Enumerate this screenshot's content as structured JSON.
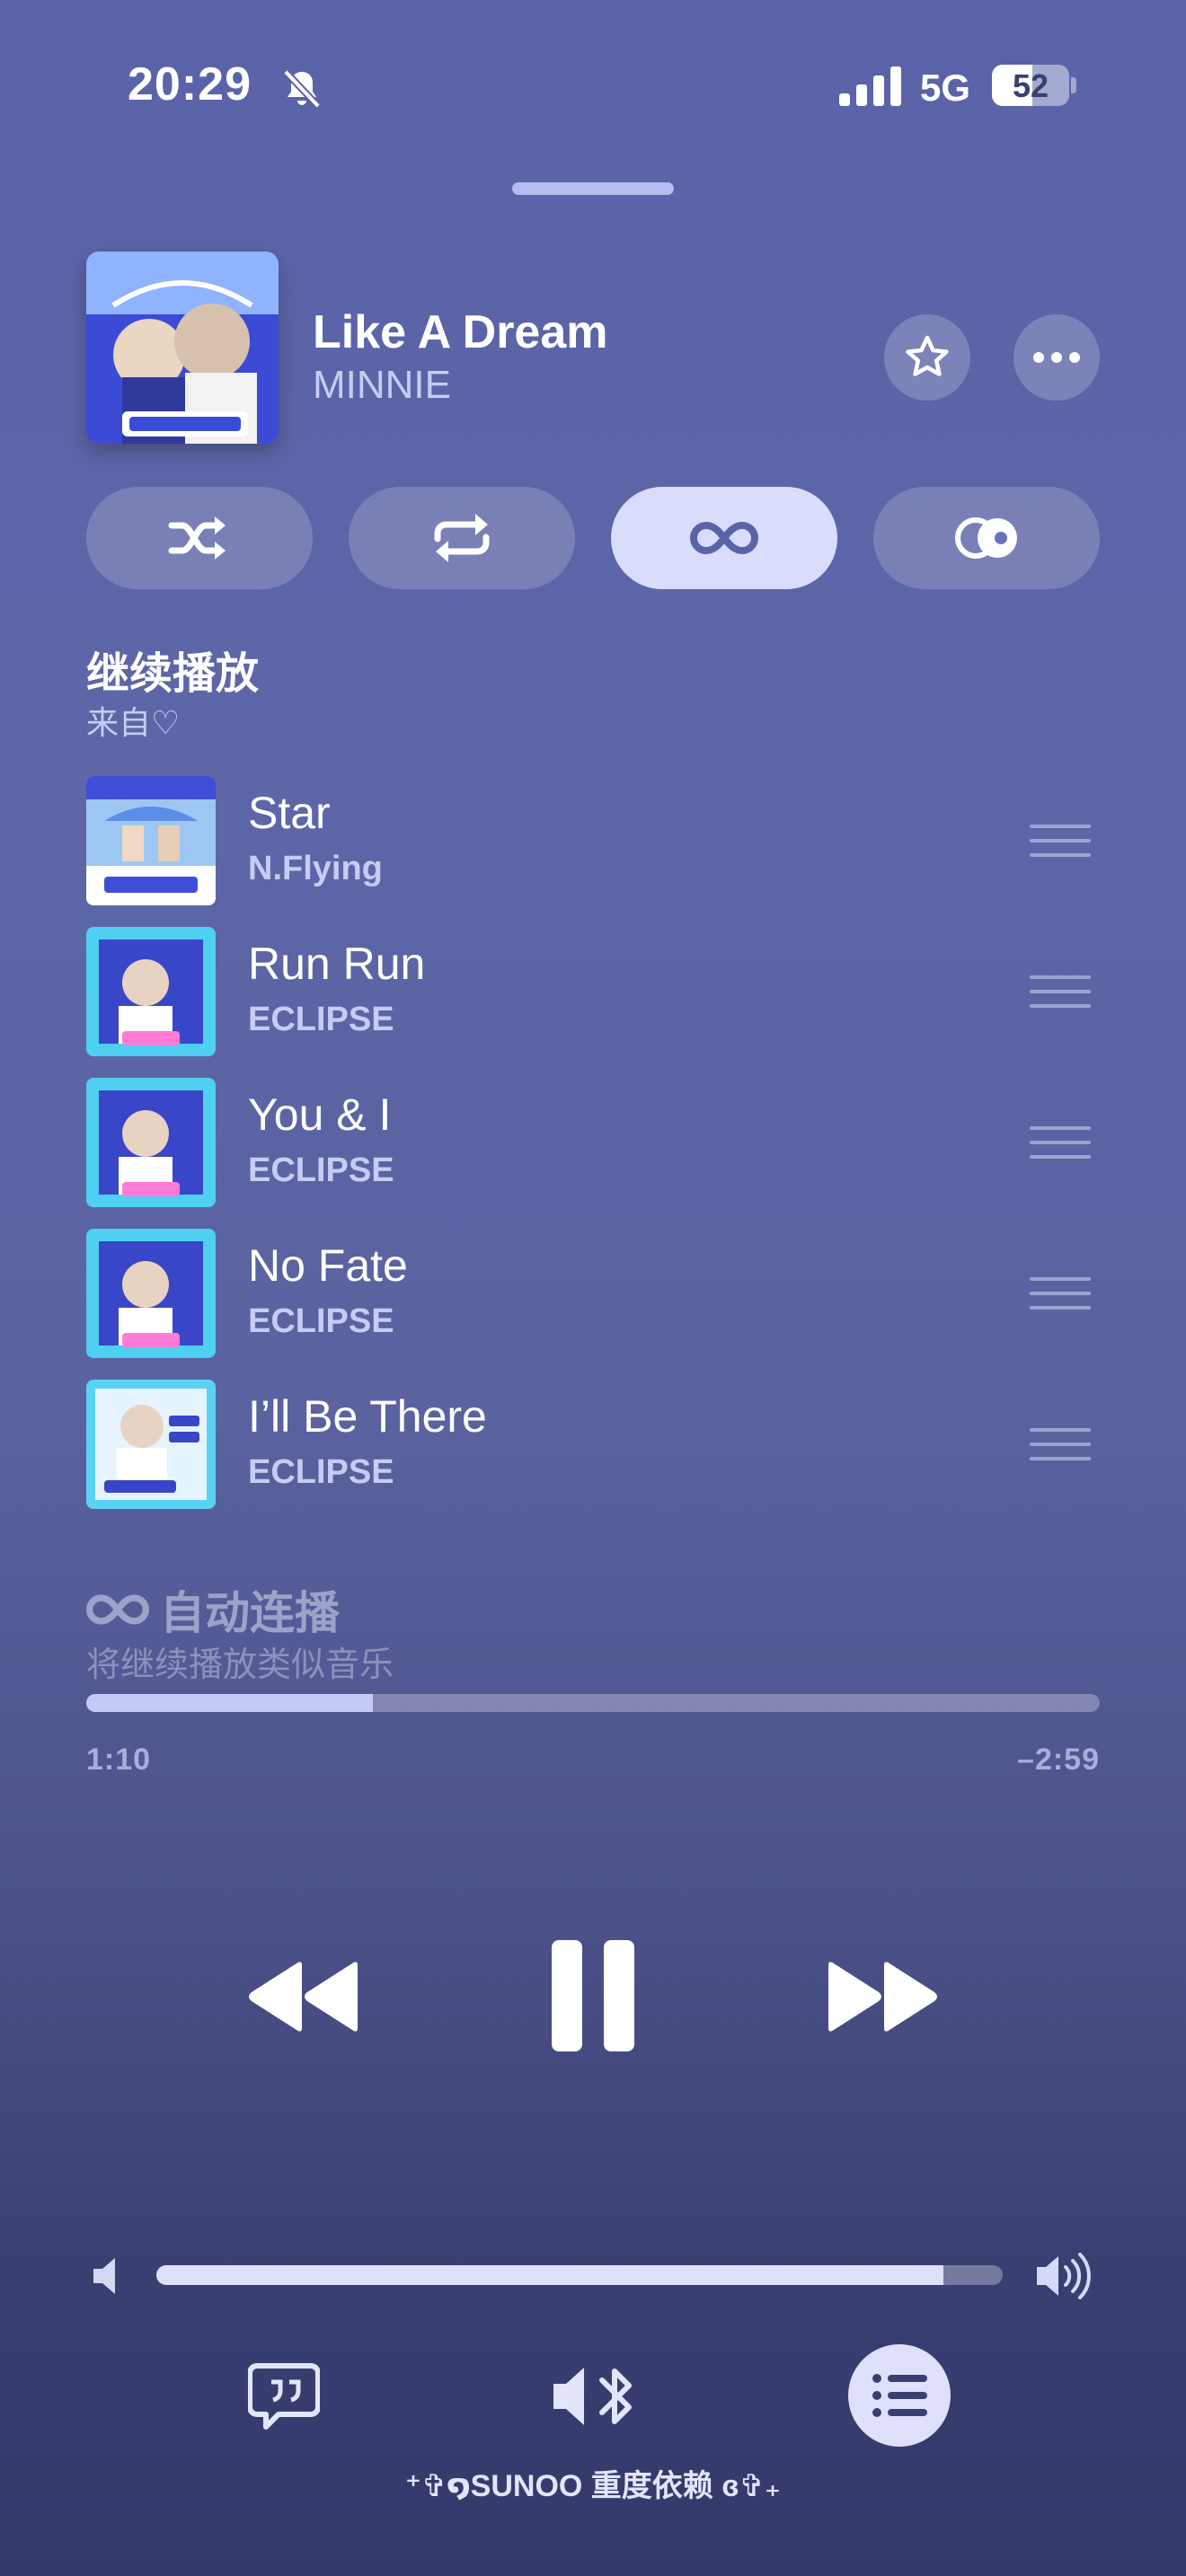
{
  "status_bar": {
    "time": "20:29",
    "network": "5G",
    "battery": "52",
    "battery_level": 0.52
  },
  "now_playing": {
    "title": "Like A Dream",
    "artist": "MINNIE",
    "album_art_text": "천재밴드부활"
  },
  "modes": [
    {
      "icon": "shuffle-icon",
      "active": false
    },
    {
      "icon": "repeat-icon",
      "active": false
    },
    {
      "icon": "infinity-icon",
      "active": true
    },
    {
      "icon": "crossfade-icon",
      "active": false
    }
  ],
  "queue_section": {
    "title": "继续播放",
    "subtitle": "来自♡"
  },
  "queue": [
    {
      "title": "Star",
      "artist": "N.Flying"
    },
    {
      "title": "Run Run",
      "artist": "ECLIPSE"
    },
    {
      "title": "You & I",
      "artist": "ECLIPSE"
    },
    {
      "title": "No Fate",
      "artist": "ECLIPSE"
    },
    {
      "title": "I’ll Be There",
      "artist": "ECLIPSE"
    }
  ],
  "autoplay": {
    "title": "自动连播",
    "subtitle": "将继续播放类似音乐"
  },
  "progress": {
    "elapsed": "1:10",
    "remaining": "–2:59",
    "fraction": 0.283
  },
  "volume": {
    "fraction": 0.93
  },
  "device_label": "⁺✞໑SUNOO 重度依赖 ɞ✞₊",
  "colors": {
    "background_top": "#5b63a8",
    "background_bottom": "#34396a",
    "accent_light": "#d9dcfb",
    "secondary_text": "#c8ccf4"
  }
}
